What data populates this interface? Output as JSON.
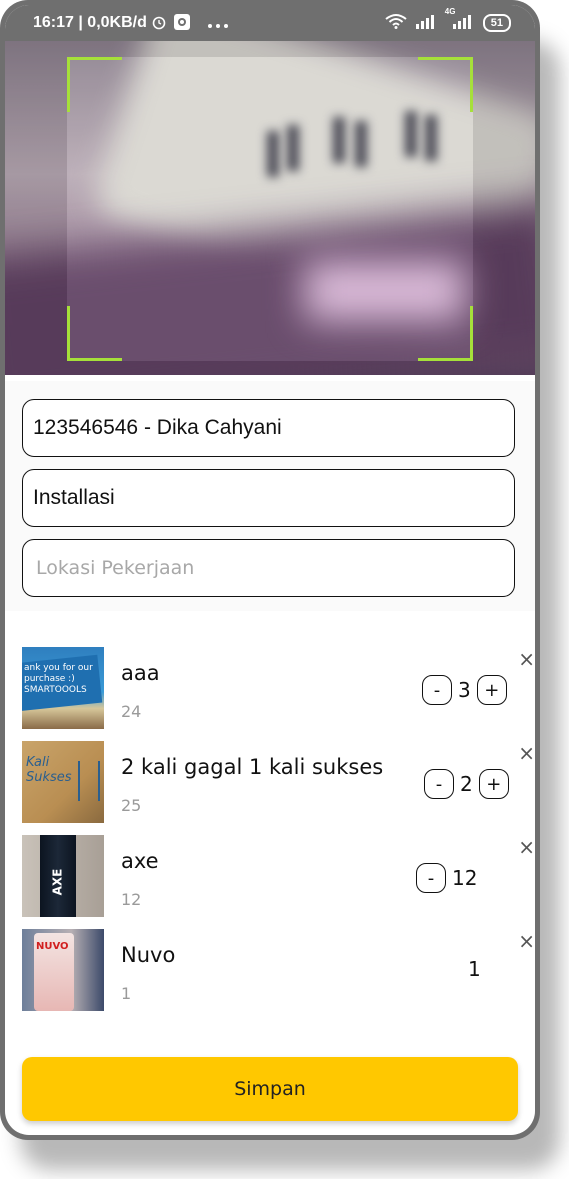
{
  "status_bar": {
    "time": "16:17 | 0,0KB/d",
    "network_label": "4G",
    "battery": "51"
  },
  "form": {
    "employee_value": "123546546 - Dika Cahyani",
    "job_type_value": "Installasi",
    "location_placeholder": "Lokasi Pekerjaan"
  },
  "items": [
    {
      "name": "aaa",
      "code": "24",
      "quantity": "3",
      "minus": "-",
      "plus": "+"
    },
    {
      "name": "2 kali gagal 1 kali sukses",
      "code": "25",
      "quantity": "2",
      "minus": "-",
      "plus": "+"
    },
    {
      "name": "axe",
      "code": "12",
      "quantity": "12",
      "minus": "-"
    },
    {
      "name": "Nuvo",
      "code": "1",
      "quantity": "1"
    }
  ],
  "thumb_text": {
    "item1": "ank you for our purchase :) SMARTOOOLS",
    "item2": "Kali Sukses",
    "item3": "AXE",
    "item4": "NUVO"
  },
  "remove_symbol": "×",
  "save_label": "Simpan",
  "colors": {
    "accent": "#ffc800",
    "scanner_corner": "#a6e03a"
  }
}
